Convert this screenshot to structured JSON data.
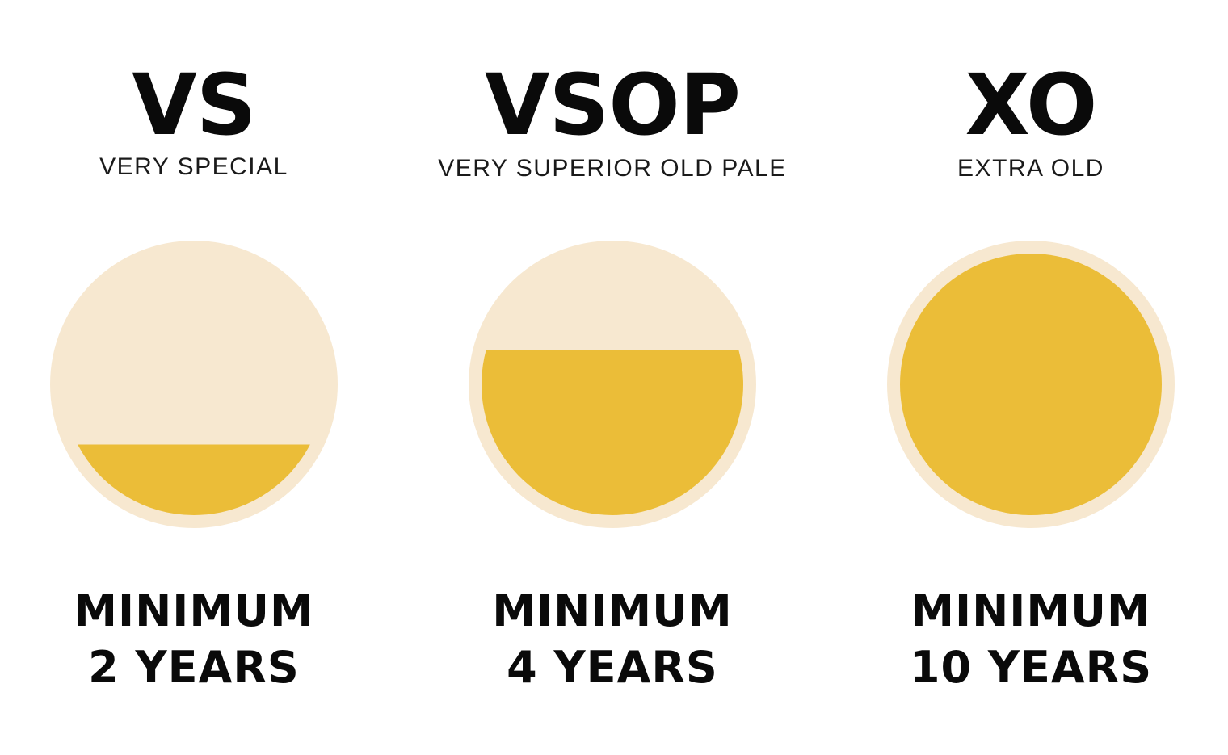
{
  "colors": {
    "background": "#ffffff",
    "glass": "#f7e8d0",
    "liquid": "#ebbd38",
    "text": "#0a0a0a"
  },
  "grades": [
    {
      "code": "VS",
      "full_name": "VERY SPECIAL",
      "minimum_label": "MINIMUM",
      "years_label": "2 YEARS",
      "fill_level": 0.27
    },
    {
      "code": "VSOP",
      "full_name": "VERY SUPERIOR OLD PALE",
      "minimum_label": "MINIMUM",
      "years_label": "4 YEARS",
      "fill_level": 0.63
    },
    {
      "code": "XO",
      "full_name": "EXTRA OLD",
      "minimum_label": "MINIMUM",
      "years_label": "10 YEARS",
      "fill_level": 1.0
    }
  ]
}
